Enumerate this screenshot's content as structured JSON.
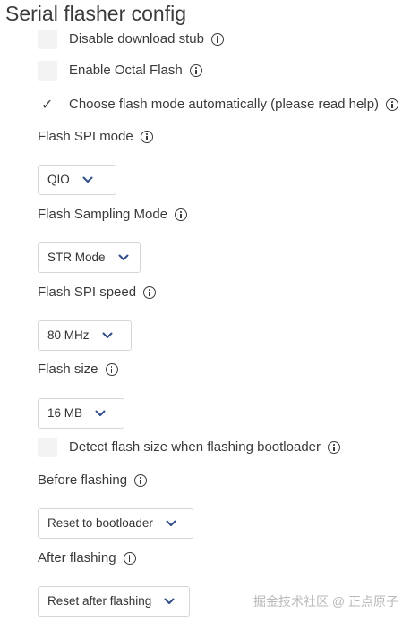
{
  "title": "Serial flasher config",
  "options": {
    "disable_download_stub": {
      "label": "Disable download stub",
      "checked": false
    },
    "enable_octal_flash": {
      "label": "Enable Octal Flash",
      "checked": false
    },
    "choose_flash_mode_auto": {
      "label": "Choose flash mode automatically (please read help)",
      "checked": true,
      "check_glyph": "✓"
    },
    "detect_flash_size": {
      "label": "Detect flash size when flashing bootloader",
      "checked": false
    }
  },
  "flash_spi_mode": {
    "label": "Flash SPI mode",
    "value": "QIO"
  },
  "flash_sampling_mode": {
    "label": "Flash Sampling Mode",
    "value": "STR Mode"
  },
  "flash_spi_speed": {
    "label": "Flash SPI speed",
    "value": "80 MHz"
  },
  "flash_size": {
    "label": "Flash size",
    "value": "16 MB"
  },
  "before_flashing": {
    "label": "Before flashing",
    "value": "Reset to bootloader"
  },
  "after_flashing": {
    "label": "After flashing",
    "value": "Reset after flashing"
  },
  "watermark": "掘金技术社区 @ 正点原子",
  "colors": {
    "chevron": "#2f4d8a",
    "checkbox_bg": "#f3f3f3",
    "text": "#3a3a3a"
  }
}
